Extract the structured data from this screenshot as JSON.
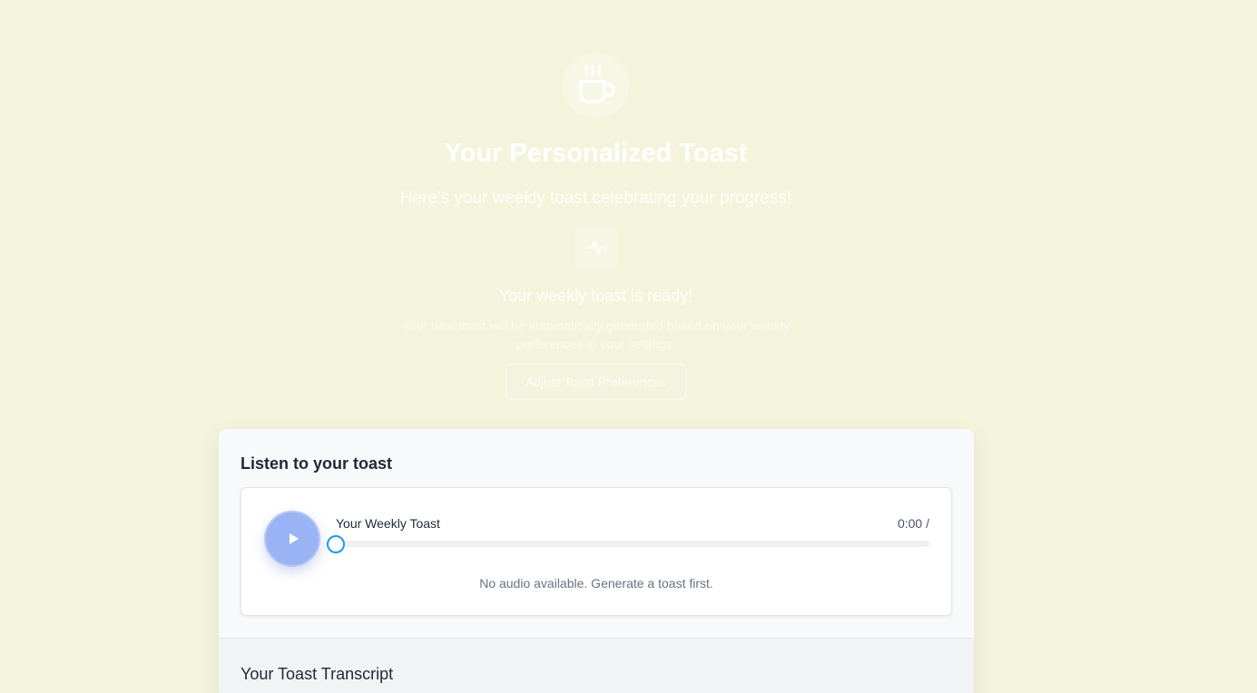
{
  "hero": {
    "icon": "coffee-cup-icon",
    "title": "Your Personalized Toast",
    "subtitle": "Here's your weekly toast celebrating your progress!",
    "status_icon": "activity-pulse-icon",
    "ready_text": "Your weekly toast is ready!",
    "next_text": "Your next toast will be automatically generated based on your weekly preferences in your settings.",
    "adjust_button": "Adjust Toast Preferences"
  },
  "player": {
    "section_title": "Listen to your toast",
    "track_title": "Your Weekly Toast",
    "time": "0:00 /",
    "progress": 0,
    "play_icon": "play-icon",
    "no_audio": "No audio available. Generate a toast first."
  },
  "transcript": {
    "title": "Your Toast Transcript"
  },
  "colors": {
    "background": "#f4f4dc",
    "accent": "#2196f3",
    "play_button": "#9ab3f5"
  }
}
